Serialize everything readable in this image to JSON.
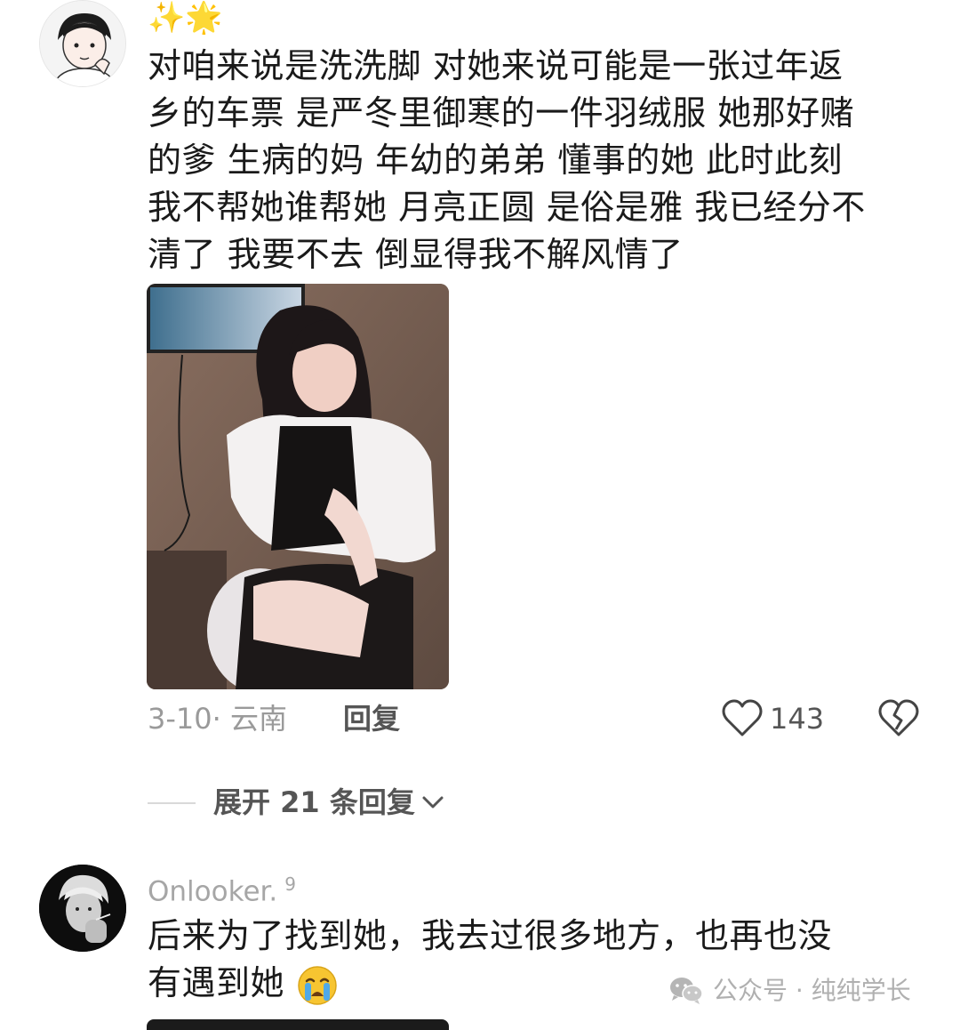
{
  "comment1": {
    "sparkles": "✨🌟",
    "text_lines": [
      "对咱来说是洗洗脚 对她来说可能是一张过年返",
      "乡的车票  是严冬里御寒的一件羽绒服 她那好赌",
      "的爹 生病的妈 年幼的弟弟  懂事的她  此时此刻",
      "我不帮她谁帮她 月亮正圆 是俗是雅 我已经分不",
      "清了 我要不去 倒显得我不解风情了"
    ],
    "date_location": "3-10· 云南",
    "reply_label": "回复",
    "likes": "143",
    "expand_label": "展开 21 条回复"
  },
  "comment2": {
    "username": "Onlooker.",
    "username_sup": "9",
    "text_lines": [
      "后来为了找到她，我去过很多地方，也再也没",
      "有遇到她"
    ]
  },
  "watermark": "公众号 · 纯纯学长",
  "icons": {
    "like": "heart-outline-icon",
    "dislike": "broken-heart-icon",
    "expand": "chevron-down-icon",
    "watermark": "wechat-icon",
    "emoji": "crying-face-icon"
  }
}
